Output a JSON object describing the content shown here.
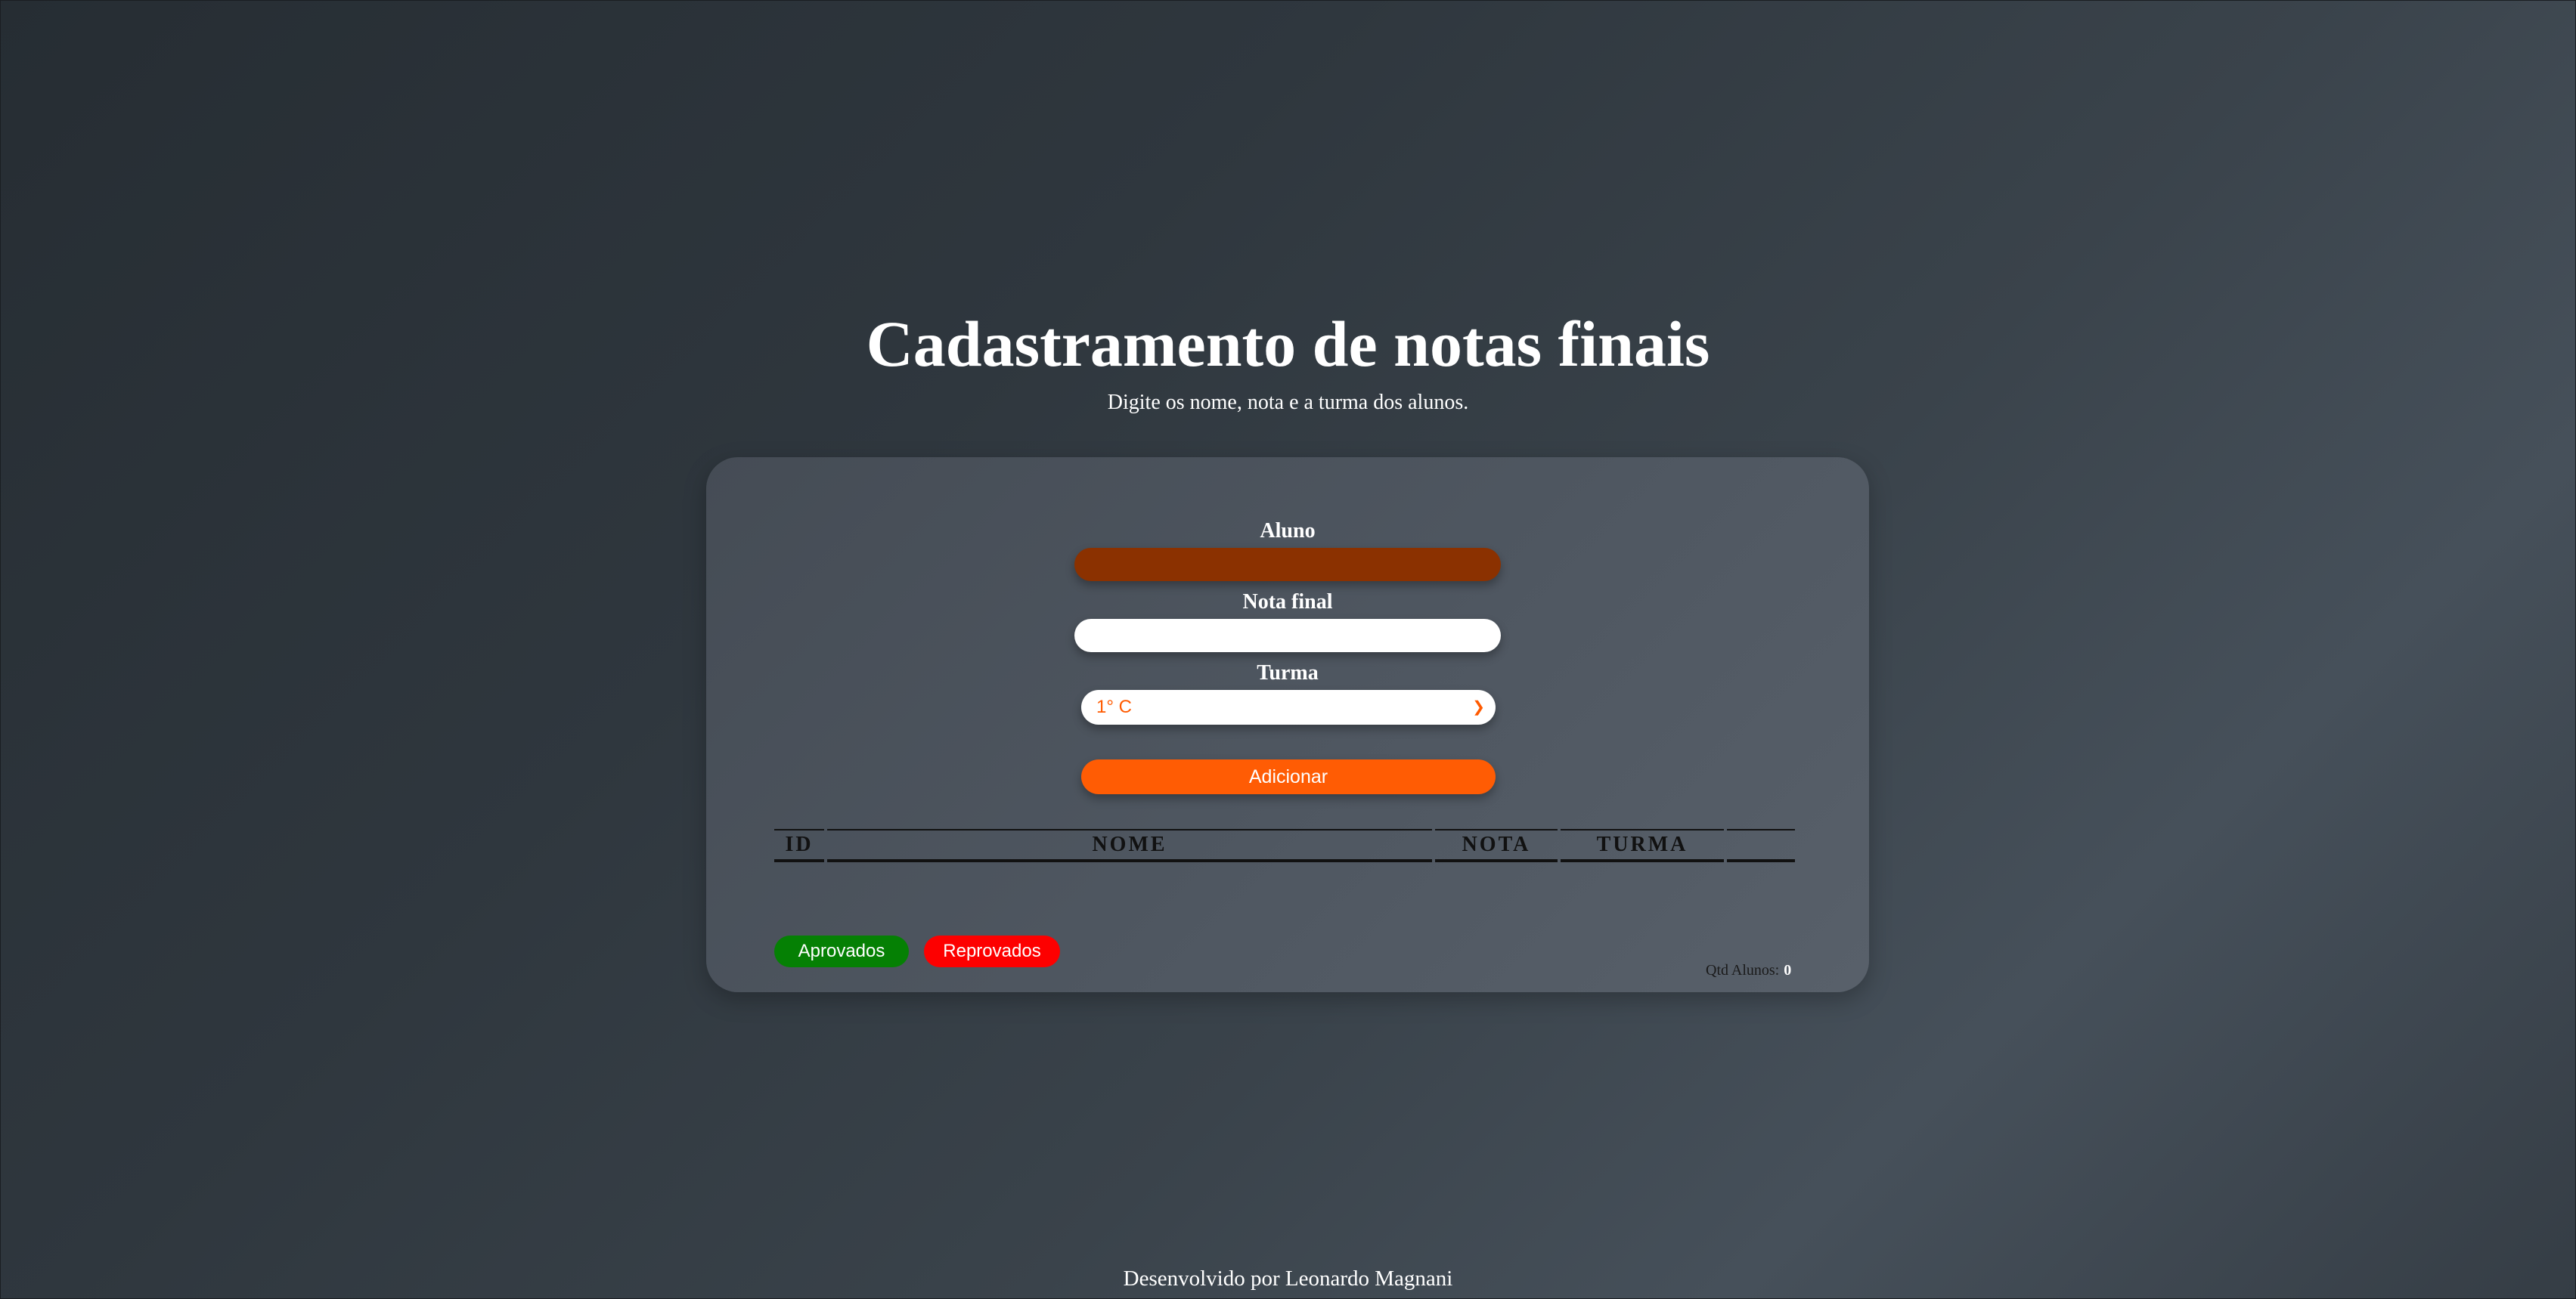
{
  "header": {
    "title": "Cadastramento de notas finais",
    "subtitle": "Digite os nome, nota e a turma dos alunos."
  },
  "form": {
    "aluno_label": "Aluno",
    "aluno_value": "",
    "nota_label": "Nota final",
    "nota_value": "",
    "turma_label": "Turma",
    "turma_selected": "1° C",
    "add_button": "Adicionar"
  },
  "table": {
    "columns": [
      "ID",
      "NOME",
      "NOTA",
      "TURMA",
      ""
    ],
    "rows": []
  },
  "filters": {
    "aprovados_label": "Aprovados",
    "reprovados_label": "Reprovados"
  },
  "stats": {
    "count_label": "Qtd Alunos:",
    "count_value": "0"
  },
  "footer": {
    "text": "Desenvolvido por Leonardo Magnani"
  },
  "colors": {
    "accent": "#ff5c04",
    "aluno_input_bg": "#8b3100",
    "aprovados": "#058004",
    "reprovados": "#fd0000",
    "card_bg": "#4f5761"
  },
  "icons": {
    "select_chevron": "chevron-down-icon"
  }
}
